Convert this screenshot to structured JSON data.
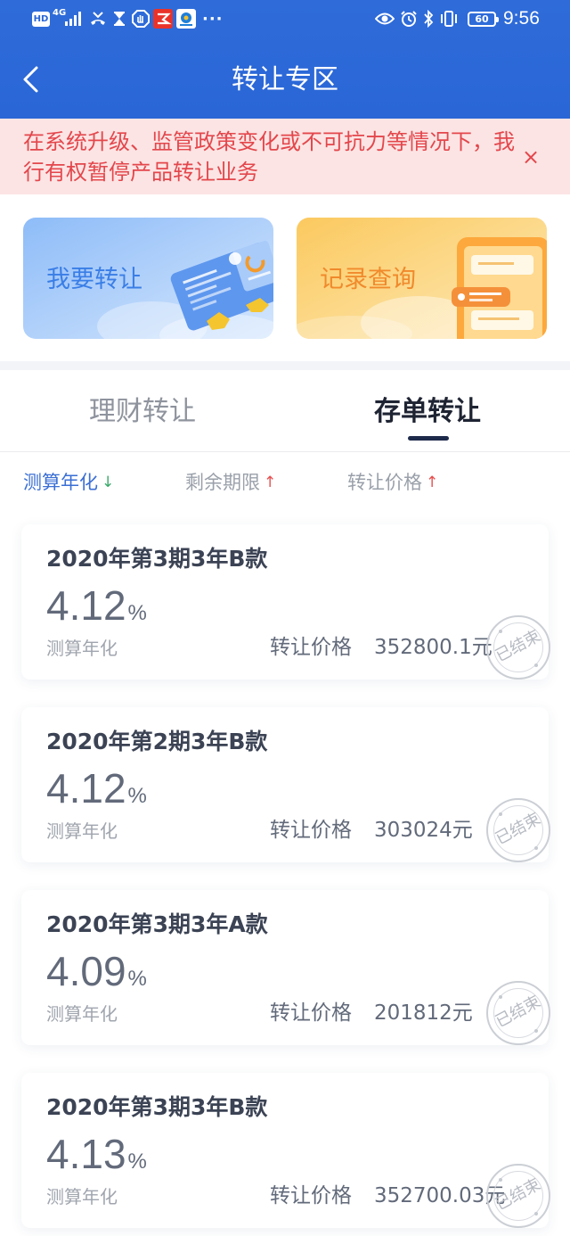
{
  "status_bar": {
    "hd": "HD",
    "network": "4G",
    "more": "···",
    "battery": "60",
    "time": "9:56",
    "left_icons": [
      "signal-icon",
      "call-icon",
      "hourglass-icon",
      "shield-icon",
      "app-red-icon",
      "app-blue-icon"
    ],
    "right_icons": [
      "eye-icon",
      "alarm-icon",
      "bluetooth-icon",
      "vibrate-icon",
      "battery-icon"
    ]
  },
  "header": {
    "title": "转让专区",
    "back_icon": "back-icon"
  },
  "notice": {
    "text": "在系统升级、监管政策变化或不可抗力等情况下，我行有权暂停产品转让业务",
    "close": "×"
  },
  "entries": [
    {
      "label": "我要转让",
      "icon": "transfer-card-illustration"
    },
    {
      "label": "记录查询",
      "icon": "phone-records-illustration"
    }
  ],
  "tabs": [
    {
      "label": "理财转让",
      "active": false
    },
    {
      "label": "存单转让",
      "active": true
    }
  ],
  "sort": [
    {
      "label": "测算年化",
      "arrow": "↓"
    },
    {
      "label": "剩余期限",
      "arrow": "↑"
    },
    {
      "label": "转让价格",
      "arrow": "↑"
    }
  ],
  "products": [
    {
      "title": "2020年第3期3年B款",
      "rate": "4.12",
      "unit": "%",
      "rate_label": "测算年化",
      "price_label": "转让价格",
      "price": "352800.1元",
      "stamp": "已结束"
    },
    {
      "title": "2020年第2期3年B款",
      "rate": "4.12",
      "unit": "%",
      "rate_label": "测算年化",
      "price_label": "转让价格",
      "price": "303024元",
      "stamp": "已结束"
    },
    {
      "title": "2020年第3期3年A款",
      "rate": "4.09",
      "unit": "%",
      "rate_label": "测算年化",
      "price_label": "转让价格",
      "price": "201812元",
      "stamp": "已结束"
    },
    {
      "title": "2020年第3期3年B款",
      "rate": "4.13",
      "unit": "%",
      "rate_label": "测算年化",
      "price_label": "转让价格",
      "price": "352700.03元",
      "stamp": "已结束"
    }
  ],
  "colors": {
    "header_bg": "#2a66d6",
    "notice_bg": "#fce4e4",
    "notice_text": "#e3474c",
    "entry_blue_text": "#3a7ee6",
    "entry_orange_text": "#f08a2c",
    "sort_active": "#3b6fd4",
    "sort_inactive": "#9aa0aa",
    "arrow_down": "#3aa86a",
    "arrow_up": "#e55050",
    "tab_indicator": "#1e2a4a"
  }
}
